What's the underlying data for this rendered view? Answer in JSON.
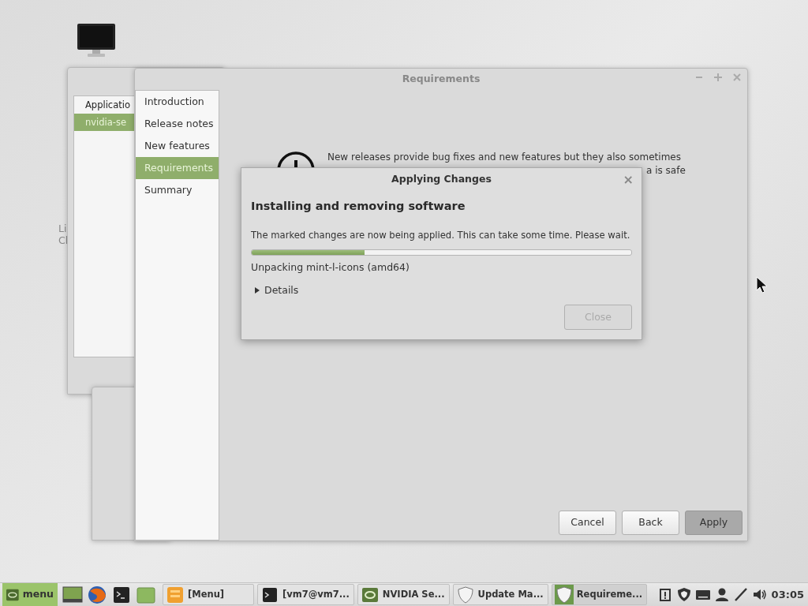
{
  "desktop": {
    "label_fragments": [
      "Li",
      "Cl"
    ]
  },
  "background_window": {
    "list_header": "Applicatio",
    "rows": [
      {
        "text": "nvidia-se",
        "selected": true
      }
    ]
  },
  "window": {
    "title": "Requirements"
  },
  "sidebar": {
    "items": [
      {
        "label": "Introduction",
        "selected": false
      },
      {
        "label": "Release notes",
        "selected": false
      },
      {
        "label": "New features",
        "selected": false
      },
      {
        "label": "Requirements",
        "selected": true
      },
      {
        "label": "Summary",
        "selected": false
      }
    ]
  },
  "notice": {
    "lines": [
      "New releases provide bug fixes and new features but they also sometimes",
      "a is safe"
    ]
  },
  "buttons": [
    {
      "label": "Cancel",
      "default": false
    },
    {
      "label": "Back",
      "default": false
    },
    {
      "label": "Apply",
      "default": true
    }
  ],
  "dialog": {
    "title": "Applying Changes",
    "close": "×",
    "heading": "Installing and removing software",
    "message": "The marked changes are now being applied. This can take some time. Please wait.",
    "progress": {
      "level": 0.297
    },
    "status": "Unpacking mint-l-icons (amd64)",
    "details": {
      "label": "Details",
      "expanded": false
    },
    "close_button": {
      "label": "Close",
      "disabled": true
    }
  },
  "taskbar": {
    "menu_label": "menu",
    "launchers": [
      {
        "kind": "desktop"
      },
      {
        "kind": "browser"
      },
      {
        "kind": "terminal"
      },
      {
        "kind": "folder"
      }
    ],
    "tasks": [
      {
        "label": "[Menu]",
        "kind": "app",
        "active": false
      },
      {
        "label": "[vm7@vm7...",
        "kind": "terminal",
        "active": false
      },
      {
        "label": "NVIDIA Se...",
        "kind": "nvidia",
        "active": false
      },
      {
        "label": "Update Ma...",
        "kind": "shield",
        "active": false
      },
      {
        "label": "Requireme...",
        "kind": "shield",
        "active": true
      }
    ],
    "tray": [
      {
        "kind": "clipboard"
      },
      {
        "kind": "shield"
      },
      {
        "kind": "keyboard"
      },
      {
        "kind": "user"
      },
      {
        "kind": "network"
      },
      {
        "kind": "volume"
      }
    ],
    "clock": "03:05"
  }
}
